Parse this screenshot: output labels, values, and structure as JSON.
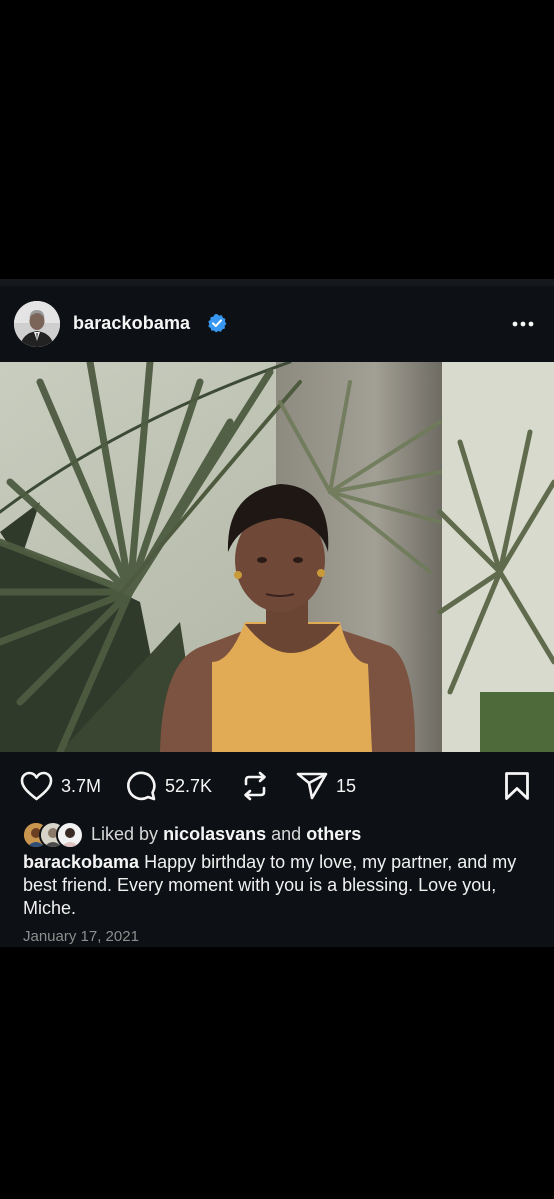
{
  "post": {
    "username": "barackobama",
    "verified_icon": "verified-badge-icon",
    "more_icon": "more-options-icon",
    "photo_alt": "photo",
    "actions": {
      "likes": "3.7M",
      "comments": "52.7K",
      "shares": "15"
    },
    "liked_by": {
      "prefix": "Liked by",
      "user": "nicolasvans",
      "connector": "and",
      "others": "others"
    },
    "caption": {
      "username": "barackobama",
      "text": "Happy birthday to my love, my partner, and my best friend. Every moment with you is a blessing. Love you, Miche."
    },
    "date": "January 17, 2021"
  },
  "colors": {
    "background": "#000000",
    "post_background": "#0d1014",
    "text": "#f5f5f5",
    "muted": "#8e8e8e",
    "verified": "#3897f0"
  }
}
